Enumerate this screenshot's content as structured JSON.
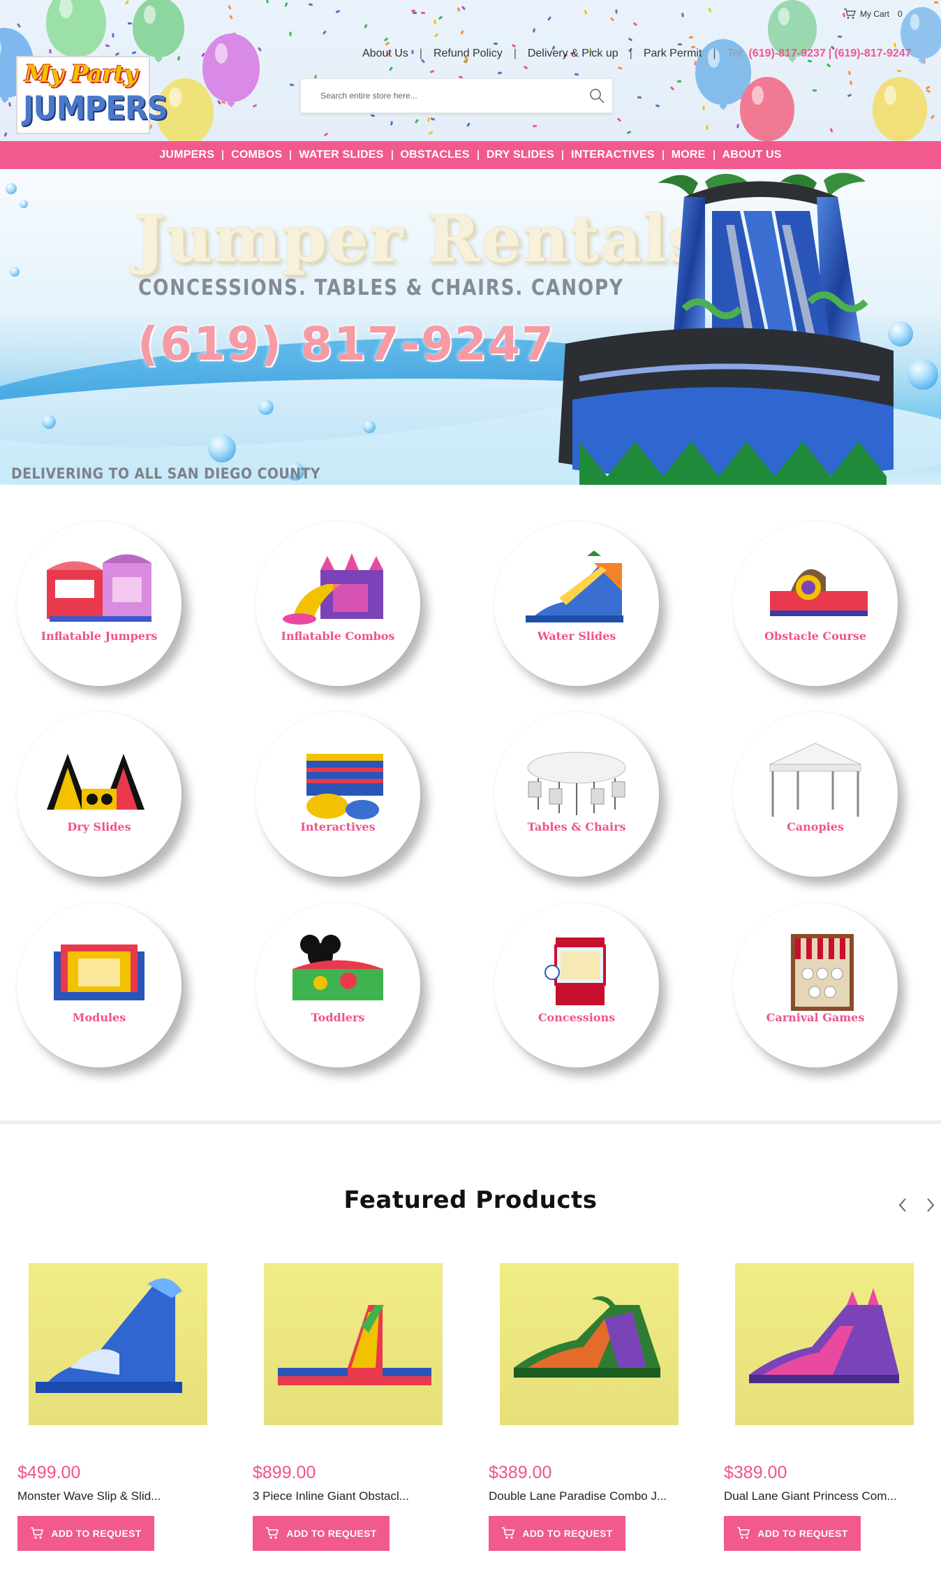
{
  "header": {
    "logo": {
      "line1": "My Party",
      "line2": "JUMPERS"
    },
    "links": [
      "About Us",
      "Refund Policy",
      "Delivery & Pick up",
      "Park Permit"
    ],
    "tel_label": "Tel:",
    "phone1": "(619)-817-9237",
    "phone_sep": "|",
    "phone2": "(619)-817-9247",
    "cart_label": "My Cart",
    "cart_count": "0",
    "search_placeholder": "Search entire store here..."
  },
  "nav": [
    "JUMPERS",
    "COMBOS",
    "WATER SLIDES",
    "OBSTACLES",
    "DRY SLIDES",
    "INTERACTIVES",
    "MORE",
    "ABOUT US"
  ],
  "banner": {
    "title": "Jumper Rentals",
    "subtitle": "CONCESSIONS.  TABLES & CHAIRS.  CANOPY",
    "phone": "(619) 817-9247",
    "delivery": "DELIVERING TO ALL SAN DIEGO COUNTY"
  },
  "categories": [
    "Inflatable Jumpers",
    "Inflatable Combos",
    "Water Slides",
    "Obstacle Course",
    "Dry Slides",
    "Interactives",
    "Tables & Chairs",
    "Canopies",
    "Modules",
    "Toddlers",
    "Concessions",
    "Carnival Games"
  ],
  "featured": {
    "title": "Featured Products",
    "button_label": "ADD TO REQUEST",
    "products": [
      {
        "price": "$499.00",
        "name": "Monster Wave Slip & Slid..."
      },
      {
        "price": "$899.00",
        "name": "3 Piece Inline Giant Obstacl..."
      },
      {
        "price": "$389.00",
        "name": "Double Lane Paradise Combo J..."
      },
      {
        "price": "$389.00",
        "name": "Dual Lane Giant Princess Com..."
      }
    ]
  },
  "colors": {
    "accent": "#f1598f",
    "price": "#f0528c",
    "nav_text": "#ffffff"
  }
}
